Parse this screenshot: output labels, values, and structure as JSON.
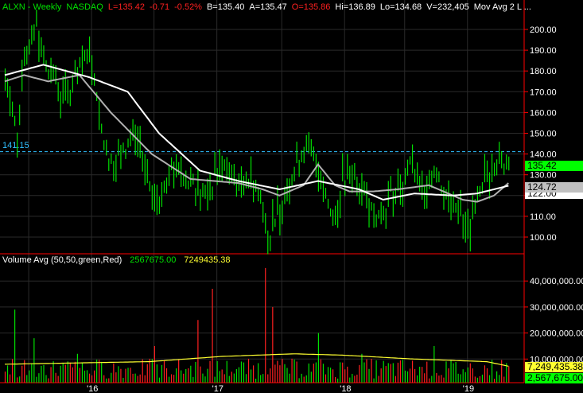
{
  "header": {
    "symbol": "ALXN - Weekly",
    "exchange": "NASDAQ",
    "last": "L=135.42",
    "change": "-0.71",
    "pct": "-0.52%",
    "bid": "B=135.40",
    "ask": "A=135.47",
    "open": "O=135.86",
    "high": "Hi=136.89",
    "low": "Lo=134.68",
    "volume": "V=232,405",
    "ma": "Mov Avg 2 L ..."
  },
  "reference_line": {
    "value": 141.15,
    "label": "141.15",
    "color": "#30c0ff"
  },
  "price_tags": {
    "last": "135.42",
    "ma1": "124.72",
    "ma2_hidden": "122.00"
  },
  "volume_legend": {
    "title": "Volume Avg (50,50,green,Red)",
    "value1": "2567675.00",
    "value2": "7249435.38"
  },
  "volume_tags": {
    "avg": "7,249,435.38",
    "last": "2,567,675.00"
  },
  "colors": {
    "up": "#00e000",
    "down": "#ff2020",
    "axis": "#ff0000",
    "grid": "#2a2a2a",
    "ma_white": "#ffffff",
    "ma_gray": "#b0b0b0",
    "vol_avg": "#ffff30"
  },
  "chart_data": {
    "type": "bar",
    "title": "ALXN - Weekly NASDAQ",
    "price_axis": {
      "ylim": [
        90,
        210
      ],
      "ticks": [
        "200.00",
        "190.00",
        "180.00",
        "170.00",
        "160.00",
        "150.00",
        "140.00",
        "130.00",
        "120.00",
        "110.00",
        "100.00"
      ]
    },
    "volume_axis": {
      "ylim": [
        0,
        48000000
      ],
      "ticks": [
        "40,000,000.00",
        "30,000,000.00",
        "20,000,000.00",
        "10,000,000.00"
      ]
    },
    "x_ticks": [
      {
        "week": 36,
        "label": "'16"
      },
      {
        "week": 88,
        "label": "'17"
      },
      {
        "week": 141,
        "label": "'18"
      },
      {
        "week": 192,
        "label": "'19"
      }
    ],
    "weeks": 210,
    "price_close_keypoints": [
      [
        0,
        180
      ],
      [
        3,
        160
      ],
      [
        5,
        150
      ],
      [
        8,
        185
      ],
      [
        13,
        205
      ],
      [
        16,
        185
      ],
      [
        21,
        175
      ],
      [
        25,
        165
      ],
      [
        30,
        180
      ],
      [
        35,
        190
      ],
      [
        38,
        170
      ],
      [
        41,
        145
      ],
      [
        45,
        135
      ],
      [
        48,
        140
      ],
      [
        53,
        150
      ],
      [
        56,
        140
      ],
      [
        59,
        125
      ],
      [
        63,
        115
      ],
      [
        66,
        125
      ],
      [
        69,
        135
      ],
      [
        74,
        130
      ],
      [
        79,
        125
      ],
      [
        84,
        120
      ],
      [
        89,
        135
      ],
      [
        94,
        130
      ],
      [
        97,
        125
      ],
      [
        101,
        128
      ],
      [
        104,
        125
      ],
      [
        107,
        115
      ],
      [
        110,
        100
      ],
      [
        114,
        115
      ],
      [
        119,
        130
      ],
      [
        124,
        145
      ],
      [
        127,
        140
      ],
      [
        130,
        135
      ],
      [
        134,
        115
      ],
      [
        137,
        110
      ],
      [
        140,
        125
      ],
      [
        145,
        130
      ],
      [
        150,
        120
      ],
      [
        155,
        110
      ],
      [
        160,
        120
      ],
      [
        165,
        125
      ],
      [
        168,
        135
      ],
      [
        173,
        120
      ],
      [
        178,
        135
      ],
      [
        183,
        120
      ],
      [
        188,
        115
      ],
      [
        191,
        100
      ],
      [
        195,
        115
      ],
      [
        200,
        130
      ],
      [
        205,
        138
      ],
      [
        209,
        135.42
      ]
    ],
    "ma_white_keypoints": [
      [
        0,
        178
      ],
      [
        16,
        183
      ],
      [
        35,
        177
      ],
      [
        51,
        170
      ],
      [
        64,
        150
      ],
      [
        81,
        132
      ],
      [
        97,
        127
      ],
      [
        114,
        123
      ],
      [
        130,
        127
      ],
      [
        147,
        123
      ],
      [
        157,
        118
      ],
      [
        170,
        121
      ],
      [
        186,
        120
      ],
      [
        196,
        121
      ],
      [
        209,
        124.72
      ]
    ],
    "ma_gray_keypoints": [
      [
        0,
        175
      ],
      [
        8,
        178
      ],
      [
        18,
        175
      ],
      [
        31,
        178
      ],
      [
        44,
        160
      ],
      [
        61,
        140
      ],
      [
        77,
        128
      ],
      [
        97,
        126
      ],
      [
        107,
        123
      ],
      [
        114,
        120
      ],
      [
        124,
        125
      ],
      [
        130,
        135
      ],
      [
        137,
        125
      ],
      [
        143,
        122
      ],
      [
        153,
        122
      ],
      [
        163,
        123
      ],
      [
        176,
        125
      ],
      [
        190,
        118
      ],
      [
        196,
        117
      ],
      [
        203,
        120
      ],
      [
        209,
        126
      ]
    ],
    "volume_spikes_millions": [
      [
        4,
        29
      ],
      [
        12,
        18
      ],
      [
        30,
        12
      ],
      [
        62,
        15
      ],
      [
        80,
        25
      ],
      [
        86,
        37
      ],
      [
        108,
        45
      ],
      [
        111,
        30
      ],
      [
        130,
        20
      ],
      [
        148,
        12
      ],
      [
        178,
        15
      ]
    ],
    "volume_base_millions": 6,
    "volume_avg_keypoints_millions": [
      [
        0,
        8
      ],
      [
        30,
        8.5
      ],
      [
        60,
        9
      ],
      [
        90,
        11
      ],
      [
        120,
        12
      ],
      [
        140,
        11.5
      ],
      [
        170,
        10
      ],
      [
        200,
        9
      ],
      [
        209,
        7.25
      ]
    ]
  }
}
